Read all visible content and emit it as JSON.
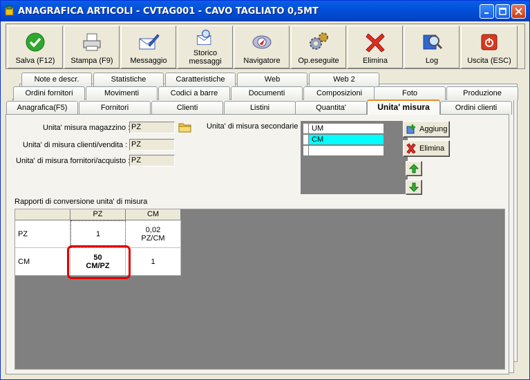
{
  "window": {
    "title": "ANAGRAFICA ARTICOLI - CVTAG001 - CAVO TAGLIATO 0,5MT"
  },
  "toolbar": {
    "buttons": [
      {
        "label": "Salva (F12)",
        "icon": "checkmark-icon"
      },
      {
        "label": "Stampa (F9)",
        "icon": "printer-icon"
      },
      {
        "label": "Messaggio",
        "icon": "envelope-pen-icon"
      },
      {
        "label": "Storico\nmessaggi",
        "icon": "envelope-search-icon"
      },
      {
        "label": "Navigatore",
        "icon": "compass-icon"
      },
      {
        "label": "Op.eseguite",
        "icon": "gears-icon"
      },
      {
        "label": "Elimina",
        "icon": "red-x-icon"
      },
      {
        "label": "Log",
        "icon": "log-search-icon"
      },
      {
        "label": "Uscita (ESC)",
        "icon": "exit-icon"
      }
    ]
  },
  "tabs": {
    "row1": [
      "Note e descr.",
      "Statistiche",
      "Caratteristiche",
      "Web",
      "Web 2"
    ],
    "row2": [
      "Ordini fornitori",
      "Movimenti",
      "Codici a barre",
      "Documenti",
      "Composizioni",
      "Foto",
      "Produzione"
    ],
    "row3": [
      "Anagrafica(F5)",
      "Fornitori",
      "Clienti",
      "Listini",
      "Quantita'",
      "Unita' misura",
      "Ordini clienti"
    ],
    "active": "Unita' misura"
  },
  "form": {
    "um_magazzino_label": "Unita' misura magazzino :",
    "um_magazzino": "PZ",
    "um_clienti_label": "Unita' di misura clienti/vendita :",
    "um_clienti": "PZ",
    "um_fornitori_label": "Unita' di misura fornitori/acquisto :",
    "um_fornitori": "PZ",
    "um_secondarie_label": "Unita' di misura secondarie :",
    "um_secondarie": [
      "UM",
      "CM",
      ""
    ],
    "selected_um": "CM",
    "aggiungi_label": "Aggiung",
    "elimina_label": "Elimina"
  },
  "conversion": {
    "title": "Rapporti di conversione unita' di misura",
    "columns": [
      "PZ",
      "CM"
    ],
    "rows": [
      {
        "label": "PZ",
        "cells": [
          "1",
          "0,02\nPZ/CM"
        ]
      },
      {
        "label": "CM",
        "cells": [
          "50\nCM/PZ",
          "1"
        ]
      }
    ]
  },
  "colors": {
    "accent": "#e68b2c",
    "highlight": "#e00000",
    "selection": "#00ffff"
  }
}
